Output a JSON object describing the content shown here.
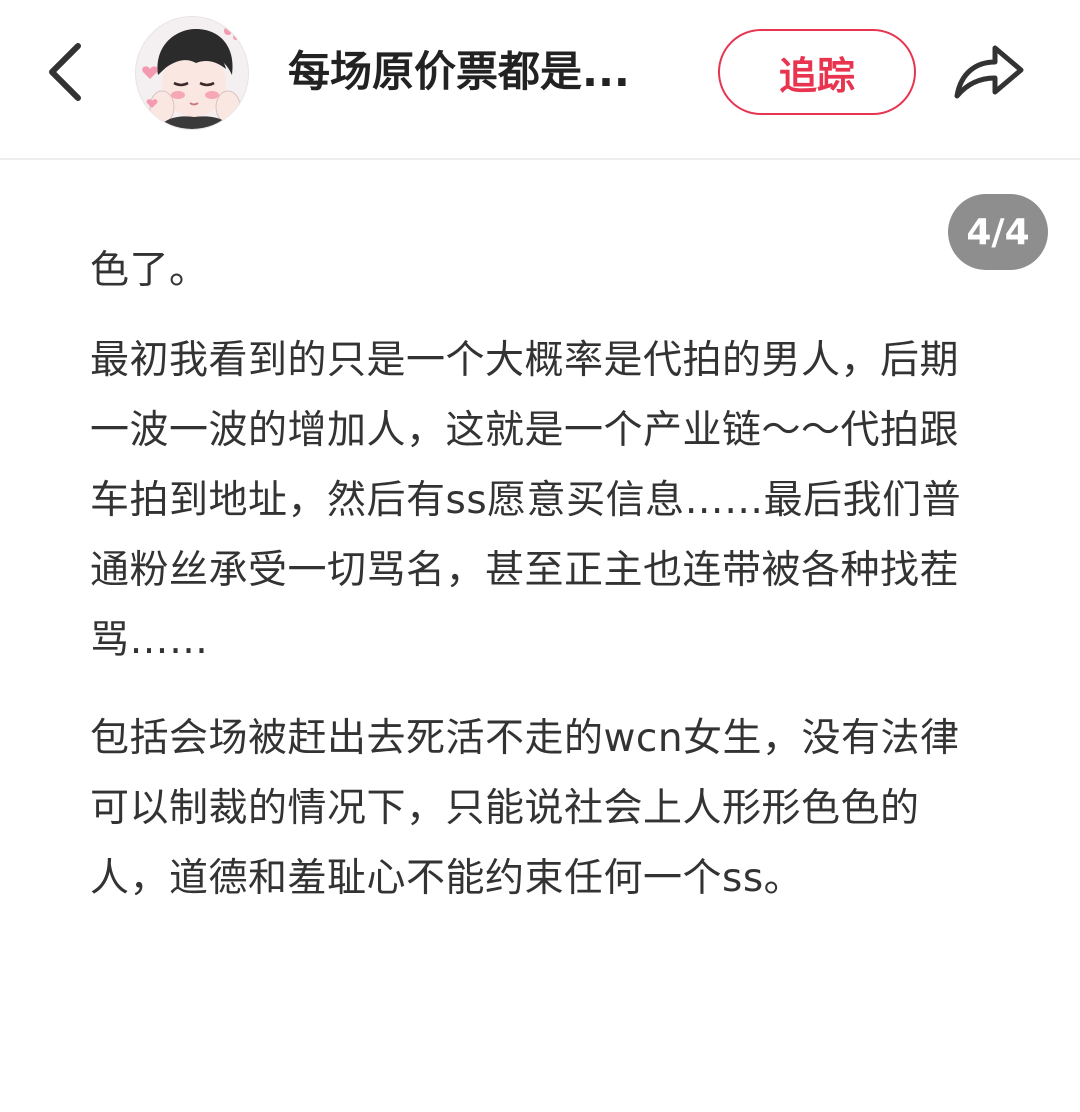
{
  "header": {
    "back_icon": "chevron-left-icon",
    "avatar_alt": "anime-boy-avatar",
    "title": "每场原价票都是...",
    "follow_label": "追踪",
    "share_icon": "share-arrow-icon",
    "accent_color": "#e8344f"
  },
  "page_indicator": "4/4",
  "paragraphs": [
    "色了。",
    "最初我看到的只是一个大概率是代拍的男人，后期一波一波的增加人，这就是一个产业链～～代拍跟车拍到地址，然后有ss愿意买信息……最后我们普通粉丝承受一切骂名，甚至正主也连带被各种找茬骂……",
    "包括会场被赶出去死活不走的wcn女生，没有法律可以制裁的情况下，只能说社会上人形形色色的人，道德和羞耻心不能约束任何一个ss。"
  ]
}
